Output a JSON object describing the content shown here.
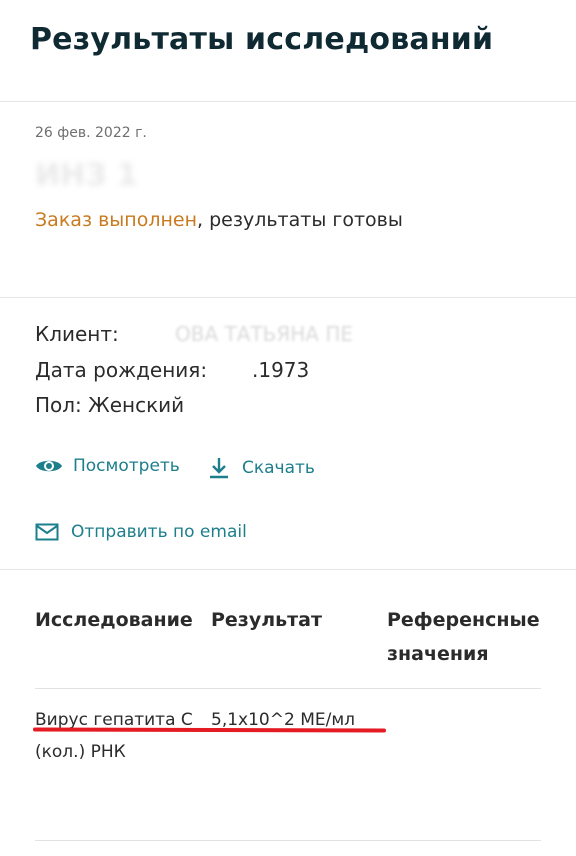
{
  "header": {
    "title": "Результаты исследований"
  },
  "order": {
    "date": "26 фев. 2022 г.",
    "number_masked": "ИНЗ 1",
    "status_accent": "Заказ выполнен",
    "status_rest": ", результаты готовы"
  },
  "client": {
    "client_label": "Клиент:",
    "client_value_masked": "ОВА ТАТЬЯНА ПЕ",
    "dob_label": "Дата рождения:",
    "dob_value": ".1973",
    "gender": "Пол: Женский"
  },
  "actions": {
    "view_label": "Посмотреть",
    "download_label": "Скачать",
    "email_label": "Отправить по email",
    "view_icon": "eye-icon",
    "download_icon": "download-icon",
    "email_icon": "envelope-icon"
  },
  "results_table": {
    "columns": [
      "Исследование",
      "Результат",
      "Референсные значения"
    ],
    "rows": [
      {
        "test": "Вирус гепатита С (кол.) РНК",
        "result": "5,1x10^2 МЕ/мл",
        "reference": ""
      }
    ]
  },
  "colors": {
    "title": "#0f2a33",
    "accent_orange": "#c97a1e",
    "link_teal": "#1d7f8c",
    "annotation_red": "#e41b23"
  }
}
